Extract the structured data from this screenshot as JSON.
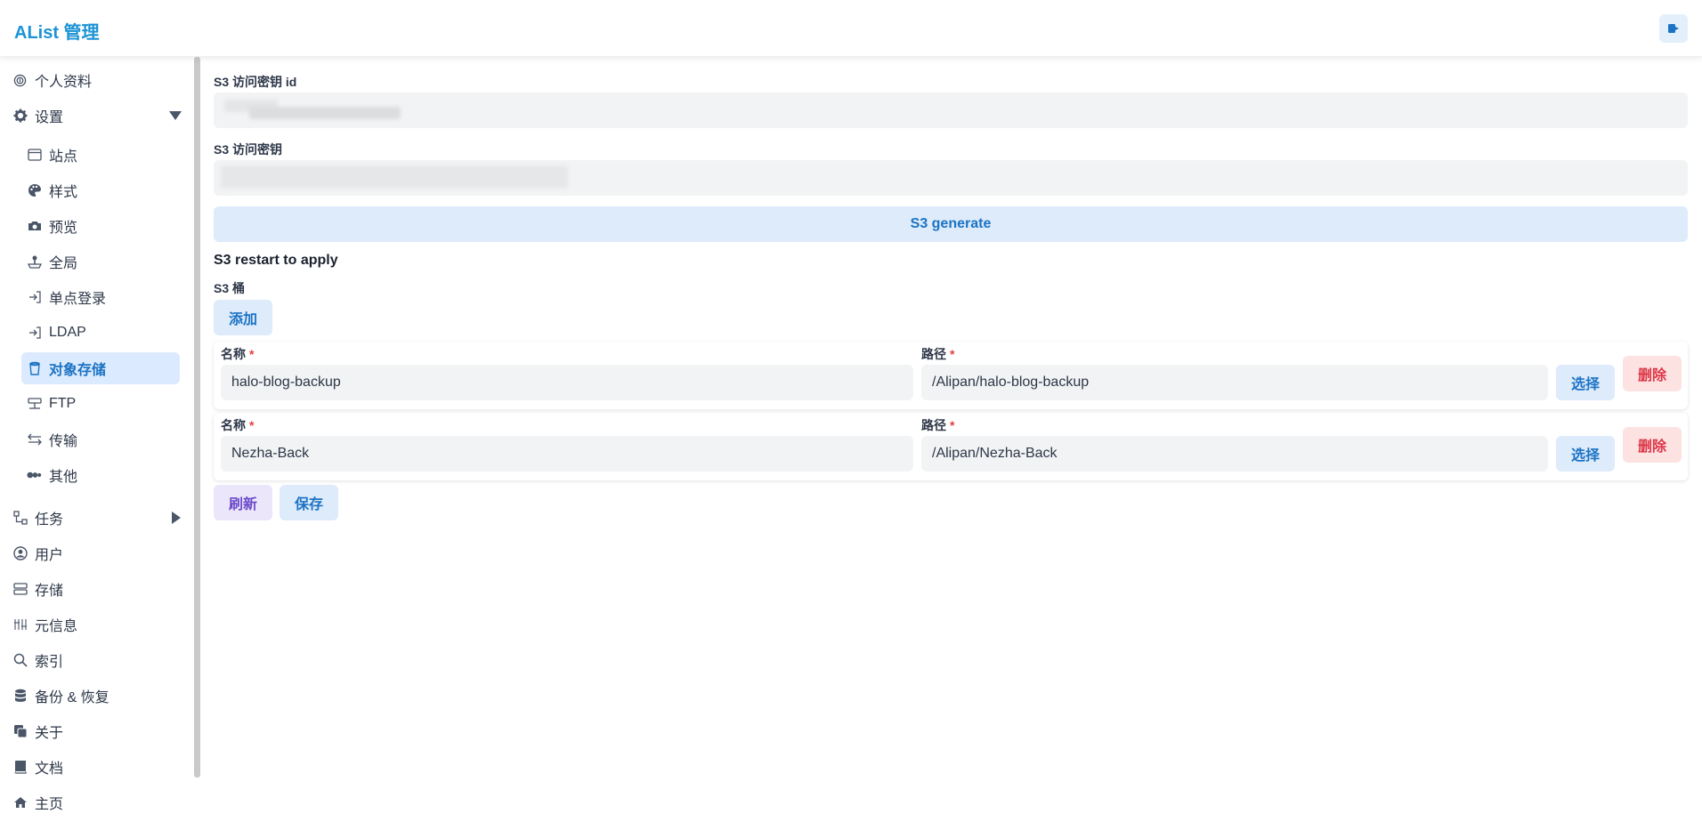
{
  "header": {
    "title": "AList 管理"
  },
  "sidebar": {
    "items": [
      {
        "label": "个人资料",
        "icon": "fingerprint-icon"
      },
      {
        "label": "设置",
        "icon": "gear-icon"
      },
      {
        "label": "站点",
        "icon": "window-icon"
      },
      {
        "label": "样式",
        "icon": "palette-icon"
      },
      {
        "label": "预览",
        "icon": "camera-icon"
      },
      {
        "label": "全局",
        "icon": "joystick-icon"
      },
      {
        "label": "单点登录",
        "icon": "login-icon"
      },
      {
        "label": "LDAP",
        "icon": "login-icon"
      },
      {
        "label": "对象存储",
        "icon": "bucket-icon"
      },
      {
        "label": "FTP",
        "icon": "ftp-icon"
      },
      {
        "label": "传输",
        "icon": "transfer-icon"
      },
      {
        "label": "其他",
        "icon": "more-icon"
      },
      {
        "label": "任务",
        "icon": "tasks-icon"
      },
      {
        "label": "用户",
        "icon": "user-icon"
      },
      {
        "label": "存储",
        "icon": "storage-icon"
      },
      {
        "label": "元信息",
        "icon": "meta-icon"
      },
      {
        "label": "索引",
        "icon": "search-icon"
      },
      {
        "label": "备份 & 恢复",
        "icon": "database-icon"
      },
      {
        "label": "关于",
        "icon": "copy-icon"
      },
      {
        "label": "文档",
        "icon": "book-icon"
      },
      {
        "label": "主页",
        "icon": "home-icon"
      }
    ],
    "active": "对象存储"
  },
  "main": {
    "access_key_id_label": "S3 访问密钥 id",
    "access_key_label": "S3 访问密钥",
    "generate_label": "S3 generate",
    "restart_note": "S3 restart to apply",
    "buckets_label": "S3 桶",
    "add_label": "添加",
    "buckets": [
      {
        "name_label": "名称",
        "name": "halo-blog-backup",
        "path_label": "路径",
        "path": "/Alipan/halo-blog-backup",
        "select_label": "选择",
        "delete_label": "删除"
      },
      {
        "name_label": "名称",
        "name": "Nezha-Back",
        "path_label": "路径",
        "path": "/Alipan/Nezha-Back",
        "select_label": "选择",
        "delete_label": "删除"
      }
    ],
    "refresh_label": "刷新",
    "save_label": "保存"
  },
  "colors": {
    "accent": "#1c93d4",
    "active_bg": "#dbeafe",
    "danger": "#dc3545"
  }
}
